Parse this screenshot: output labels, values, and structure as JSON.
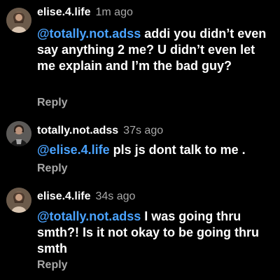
{
  "colors": {
    "background": "#000000",
    "text": "#ffffff",
    "mention": "#4aa3ff",
    "muted": "#a8a8a8"
  },
  "comments": [
    {
      "username": "elise.4.life",
      "timestamp": "1m ago",
      "mention": "@totally.not.adss",
      "text": " addi you didn’t even say anything 2 me? U didn’t even let me explain and I’m the bad guy?",
      "reply_label": "Reply",
      "avatar_icon": "profile-photo-icon"
    },
    {
      "username": "totally.not.adss",
      "timestamp": "37s ago",
      "mention": "@elise.4.life",
      "text": " pls js dont talk to me .",
      "reply_label": "Reply",
      "avatar_icon": "profile-photo-icon"
    },
    {
      "username": "elise.4.life",
      "timestamp": "34s ago",
      "mention": "@totally.not.adss",
      "text": " I was going thru smth?! Is it not okay to be going thru smth",
      "reply_label": "Reply",
      "avatar_icon": "profile-photo-icon"
    }
  ]
}
